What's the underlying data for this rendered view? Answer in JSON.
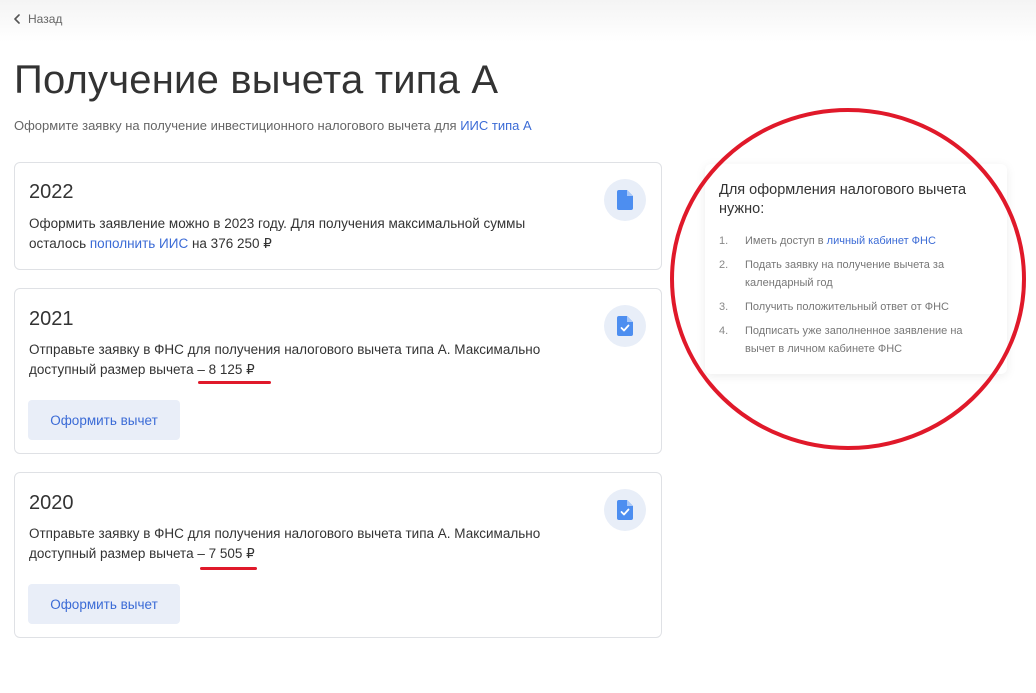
{
  "nav": {
    "back_label": "Назад"
  },
  "header": {
    "title": "Получение вычета типа А",
    "subtitle_prefix": "Оформите заявку на получение инвестиционного налогового вычета для ",
    "subtitle_link": "ИИС типа А"
  },
  "cards": [
    {
      "year": "2022",
      "text_line1": "Оформить заявление можно в 2023 году. Для получения максимальной суммы",
      "text_prefix": "осталось ",
      "text_link": "пополнить ИИС",
      "text_suffix": " на 376 250 ₽",
      "icon": "document-icon"
    },
    {
      "year": "2021",
      "text_line1": "Отправьте заявку в ФНС для получения налогового вычета типа А. Максимально",
      "text_line2": "доступный размер вычета – ",
      "amount": "8 125 ₽",
      "button_label": "Оформить вычет",
      "icon": "document-check-icon"
    },
    {
      "year": "2020",
      "text_line1": "Отправьте заявку в ФНС для получения налогового вычета типа А. Максимально",
      "text_line2": "доступный размер вычета – ",
      "amount": "7 505 ₽",
      "button_label": "Оформить вычет",
      "icon": "document-check-icon"
    }
  ],
  "info": {
    "title": "Для оформления налогового вычета нужно:",
    "steps": [
      {
        "num": "1.",
        "prefix": "Иметь доступ в ",
        "link": "личный кабинет ФНС"
      },
      {
        "num": "2.",
        "text": "Подать заявку на получение вычета за календарный год"
      },
      {
        "num": "3.",
        "text": "Получить положительный ответ от ФНС"
      },
      {
        "num": "4.",
        "text": "Подписать уже заполненное заявление на вычет в личном кабинете ФНС"
      }
    ]
  },
  "colors": {
    "accent": "#3b6bd6",
    "annotation_red": "#e0192a",
    "icon_blue": "#4d8ef0"
  }
}
